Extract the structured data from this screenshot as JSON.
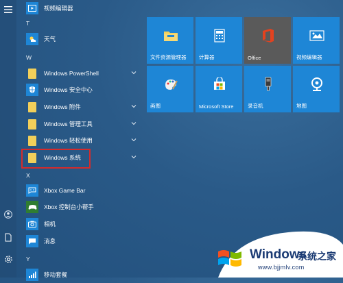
{
  "rail": {
    "icons": [
      "hamburger-menu-icon",
      "user-icon",
      "document-icon",
      "settings-icon"
    ]
  },
  "applist": {
    "top_item": {
      "label": "视频编辑器"
    },
    "letter_t": "T",
    "weather": {
      "label": "天气"
    },
    "letter_w": "W",
    "powershell": {
      "label": "Windows PowerShell"
    },
    "security": {
      "label": "Windows 安全中心"
    },
    "accessories": {
      "label": "Windows 附件"
    },
    "admin_tools": {
      "label": "Windows 管理工具"
    },
    "ease_access": {
      "label": "Windows 轻松使用"
    },
    "system": {
      "label": "Windows 系统"
    },
    "letter_x": "X",
    "xbox_game_bar": {
      "label": "Xbox Game Bar"
    },
    "xbox_console": {
      "label": "Xbox 控制台小帮手"
    },
    "camera": {
      "label": "相机"
    },
    "messages": {
      "label": "消息"
    },
    "letter_y": "Y",
    "mobile_plan": {
      "label": "移动套餐"
    }
  },
  "tiles": [
    {
      "label": "文件资源管理器",
      "icon": "folder-explorer-icon"
    },
    {
      "label": "计算器",
      "icon": "calculator-icon"
    },
    {
      "label": "Office",
      "icon": "office-icon"
    },
    {
      "label": "视频编辑器",
      "icon": "video-editor-icon"
    },
    {
      "label": "画图",
      "icon": "paint-icon"
    },
    {
      "label": "Microsoft Store",
      "icon": "store-icon"
    },
    {
      "label": "录音机",
      "icon": "recorder-icon"
    },
    {
      "label": "地图",
      "icon": "maps-icon"
    }
  ],
  "watermark": {
    "brand": "Windows",
    "suffix": "系统之家",
    "url": "www.bjjmlv.com"
  },
  "colors": {
    "tile_blue": "#1e86d6",
    "office_tile": "#5a5a5a",
    "folder_yellow": "#f2cf5a",
    "highlight_red": "#d62b2b"
  }
}
